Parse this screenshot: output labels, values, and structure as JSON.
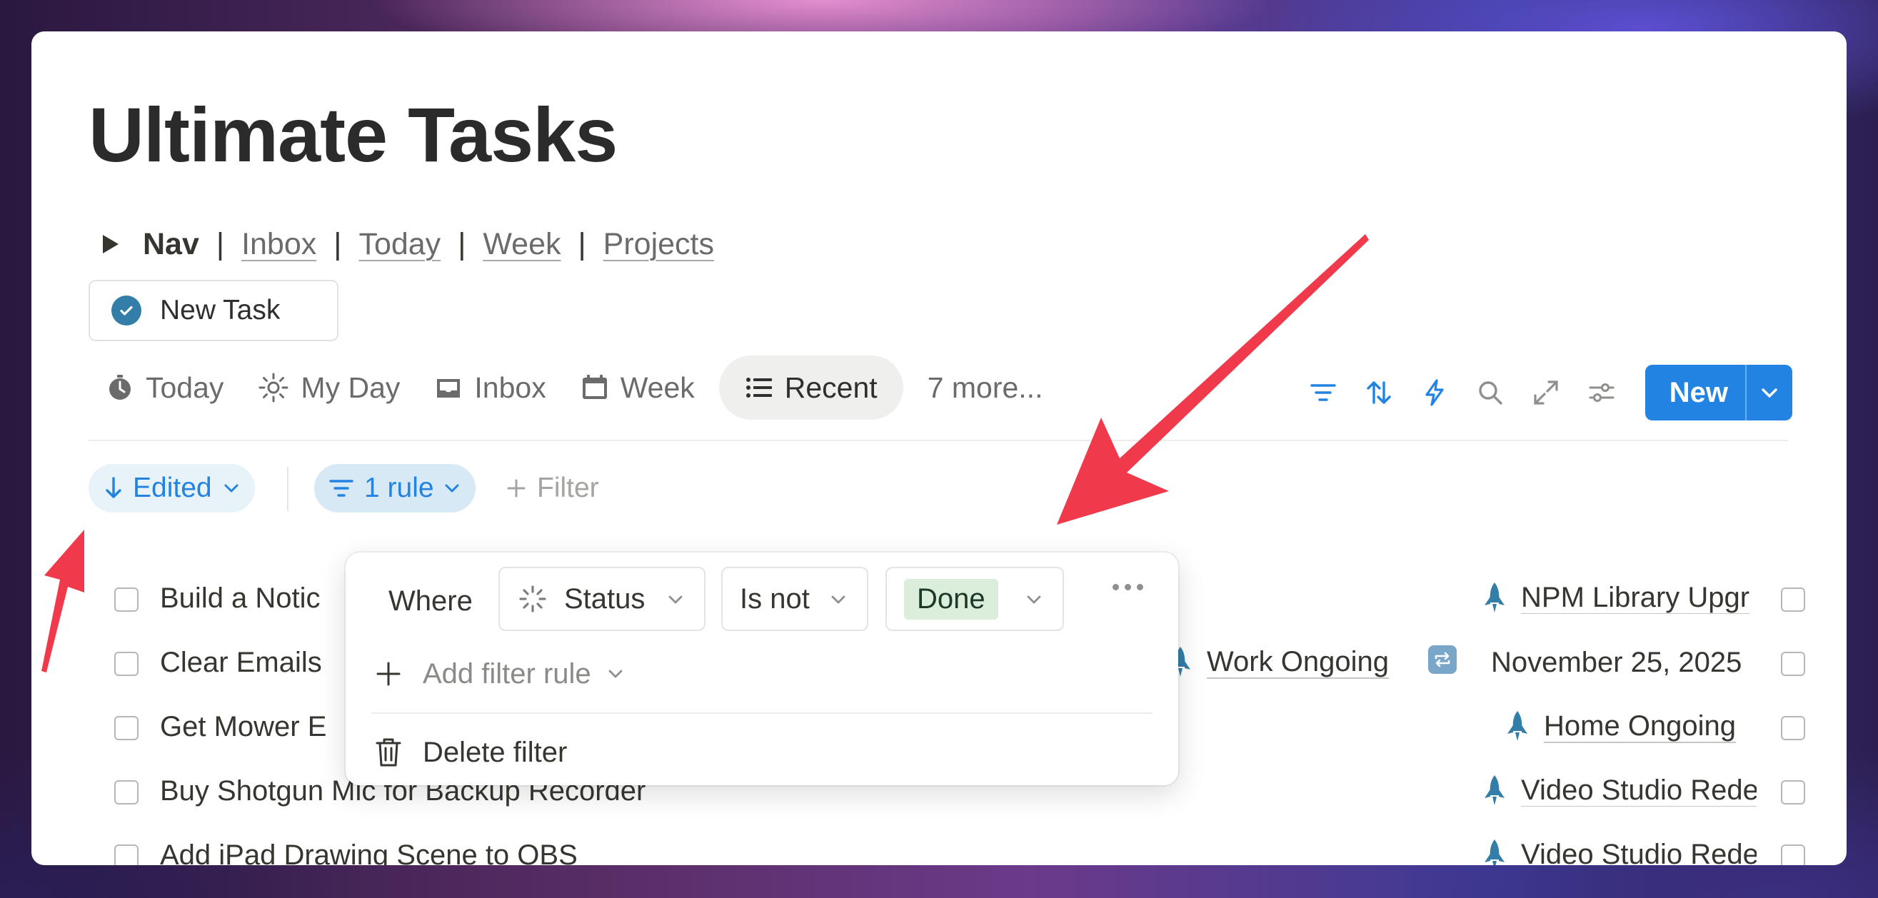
{
  "page": {
    "title": "Ultimate Tasks"
  },
  "nav": {
    "label": "Nav",
    "separator": "|",
    "links": [
      "Inbox",
      "Today",
      "Week",
      "Projects"
    ]
  },
  "new_task_button": {
    "label": "New Task"
  },
  "tabs": [
    {
      "label": "Today",
      "icon": "stopwatch-icon"
    },
    {
      "label": "My Day",
      "icon": "sun-icon"
    },
    {
      "label": "Inbox",
      "icon": "inbox-tray-icon"
    },
    {
      "label": "Week",
      "icon": "calendar-icon"
    },
    {
      "label": "Recent",
      "icon": "list-icon",
      "active": true
    },
    {
      "label": "7 more..."
    }
  ],
  "toolbar": {
    "tools": [
      "filter-icon",
      "sort-icon",
      "lightning-icon",
      "search-icon",
      "expand-icon",
      "settings-sliders-icon"
    ],
    "new_label": "New"
  },
  "filter_bar": {
    "sort_label": "Edited",
    "rule_label": "1 rule",
    "add_filter_label": "Filter"
  },
  "rows": [
    {
      "title": "Build a Notic",
      "project": "NPM Library Upgr",
      "date": ""
    },
    {
      "title": "Clear Emails",
      "project": "Work Ongoing",
      "date": "November 25, 2025"
    },
    {
      "title": "Get Mower E",
      "project": "Home Ongoing",
      "date": ""
    },
    {
      "title": "Buy Shotgun Mic for Backup Recorder",
      "project": "Video Studio Rede",
      "date": ""
    },
    {
      "title": "Add iPad Drawing Scene to OBS",
      "project": "Video Studio Rede",
      "date": ""
    }
  ],
  "filter_popover": {
    "where_label": "Where",
    "property": "Status",
    "operator": "Is not",
    "value": "Done",
    "add_rule_label": "Add filter rule",
    "delete_label": "Delete filter"
  },
  "colors": {
    "accent": "#2383e2",
    "icon_blue": "#337ea9",
    "done_tag_bg": "#dbeddb",
    "arrow_red": "#f03a4b"
  }
}
